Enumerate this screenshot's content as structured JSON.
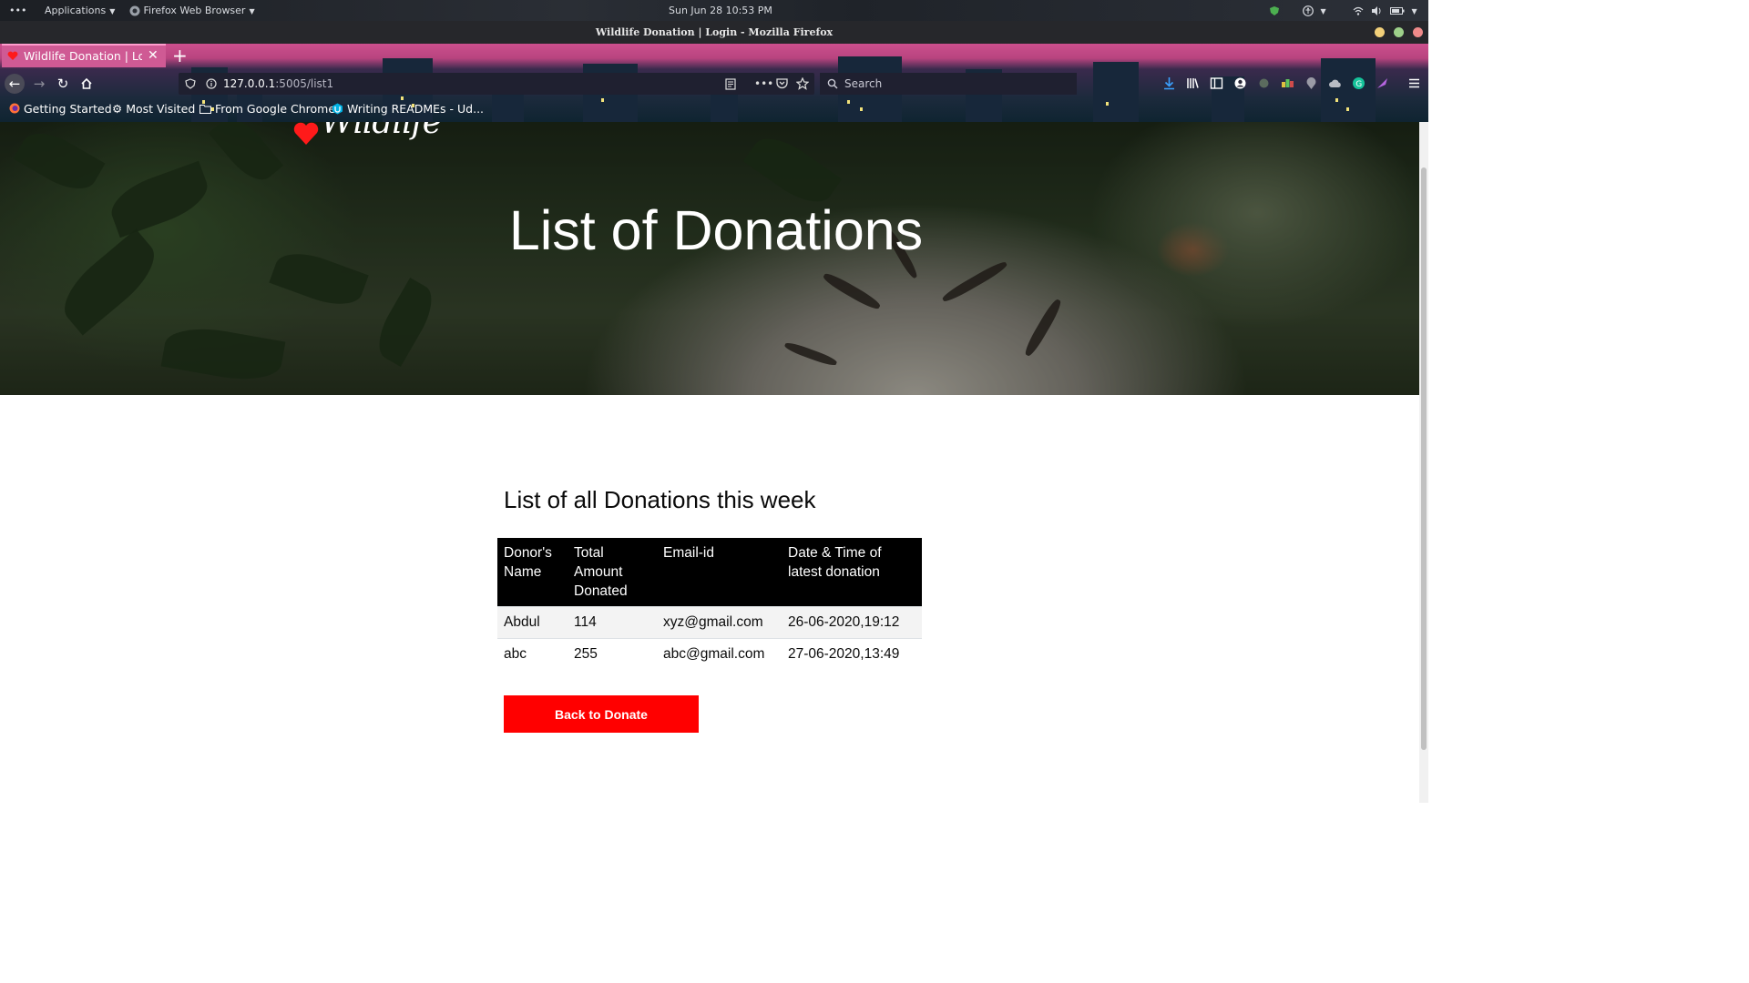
{
  "top_panel": {
    "menu_dots": "•••",
    "applications": "Applications",
    "active_app": "Firefox Web Browser",
    "clock": "Sun Jun 28  10:53 PM"
  },
  "window": {
    "title": "Wildlife Donation | Login - Mozilla Firefox"
  },
  "browser": {
    "tab_title": "Wildlife Donation | Login",
    "new_tab_symbol": "+",
    "url_host": "127.0.0.1",
    "url_path": ":5005/list1",
    "search_placeholder": "Search",
    "toolbar_ellipsis": "•••"
  },
  "bookmarks": [
    {
      "label": "Getting Started",
      "icon": "firefox-icon"
    },
    {
      "label": "Most Visited",
      "icon": "gear-icon"
    },
    {
      "label": "From Google Chrome",
      "icon": "folder-icon"
    },
    {
      "label": "Writing READMEs - Ud...",
      "icon": "udacity-icon"
    }
  ],
  "page": {
    "logo_text": "Wildlife",
    "hero_title": "List of Donations",
    "list_heading": "List of all Donations this week",
    "table": {
      "headers": [
        "Donor's Name",
        "Total Amount Donated",
        "Email-id",
        "Date & Time of latest donation"
      ],
      "rows": [
        [
          "Abdul",
          "114",
          "xyz@gmail.com",
          "26-06-2020,19:12"
        ],
        [
          "abc",
          "255",
          "abc@gmail.com",
          "27-06-2020,13:49"
        ]
      ]
    },
    "back_button": "Back to Donate"
  },
  "colors": {
    "accent": "#ff0000",
    "table_header_bg": "#000000",
    "theme_pink": "#cf5a94"
  }
}
